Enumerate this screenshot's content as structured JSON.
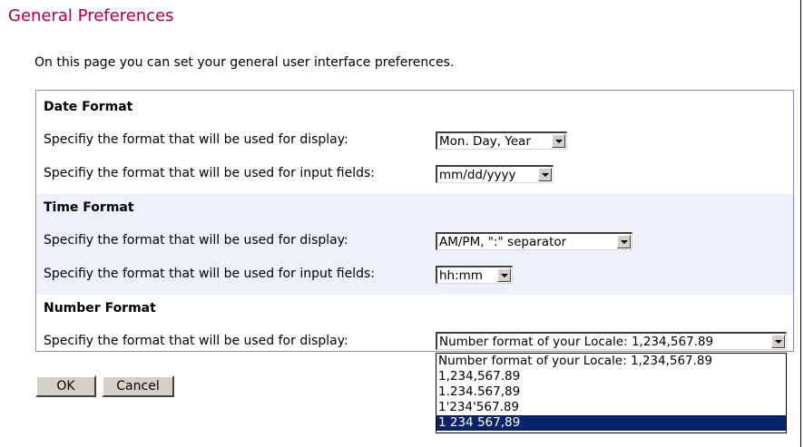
{
  "page": {
    "title": "General Preferences",
    "intro": "On this page you can set your general user interface preferences."
  },
  "date_format": {
    "heading": "Date Format",
    "display_label": "Specifiy the format that will be used for display:",
    "display_value": "Mon. Day, Year",
    "input_label": "Specifiy the format that will be used for input fields:",
    "input_value": "mm/dd/yyyy"
  },
  "time_format": {
    "heading": "Time Format",
    "display_label": "Specifiy the format that will be used for display:",
    "display_value": "AM/PM, \":\" separator",
    "input_label": "Specifiy the format that will be used for input fields:",
    "input_value": "hh:mm"
  },
  "number_format": {
    "heading": "Number Format",
    "display_label": "Specifiy the format that will be used for display:",
    "display_value": "Number format of your Locale: 1,234,567.89",
    "options": [
      "Number format of your Locale: 1,234,567.89",
      "1,234,567.89",
      "1.234.567,89",
      "1'234'567.89",
      "1 234 567,89"
    ],
    "highlighted_option": "1 234 567,89"
  },
  "buttons": {
    "ok": "OK",
    "cancel": "Cancel"
  },
  "colors": {
    "title": "#b0003a",
    "box_border": "#8a8ecc",
    "band_background": "#eef0fa",
    "selection": "#0a246a"
  }
}
